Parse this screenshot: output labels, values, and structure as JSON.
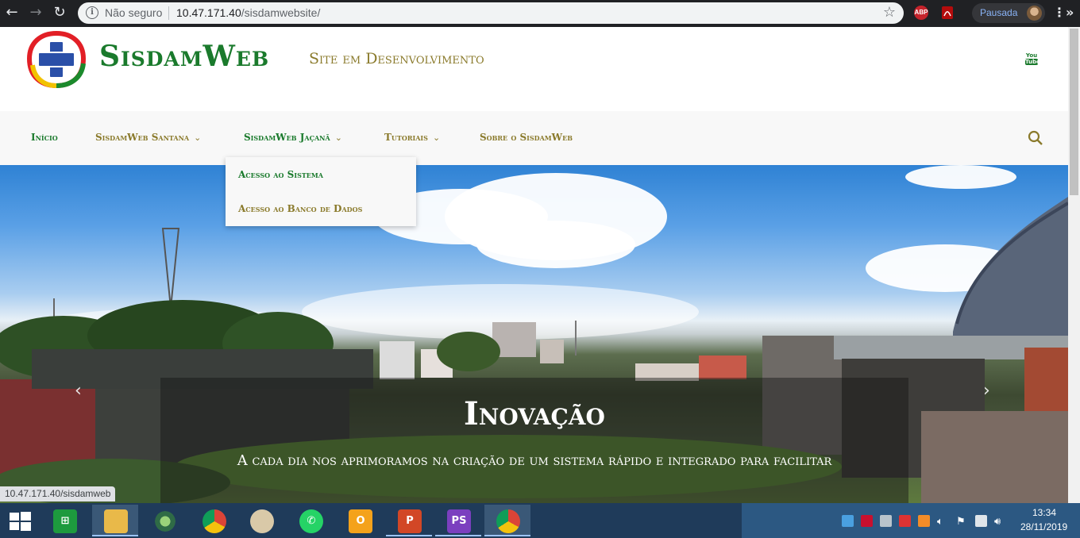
{
  "browser": {
    "security_label": "Não seguro",
    "url_host": "10.47.171.40",
    "url_path": "/sisdamwebsite/",
    "profile_label": "Pausada",
    "ext_abp": "ABP"
  },
  "site": {
    "title": "SisdamWeb",
    "tagline": "Site em Desenvolvimento",
    "youtube_top": "You",
    "youtube_bottom": "Tube"
  },
  "nav": {
    "items": [
      {
        "label": "Início",
        "has_caret": false
      },
      {
        "label": "SisdamWeb Santana",
        "has_caret": true
      },
      {
        "label": "SisdamWeb Jaçanã",
        "has_caret": true
      },
      {
        "label": "Tutoriais",
        "has_caret": true
      },
      {
        "label": "Sobre o SisdamWeb",
        "has_caret": false
      }
    ],
    "dropdown": [
      "Acesso ao Sistema",
      "Acesso ao Banco de Dados"
    ]
  },
  "hero": {
    "title": "Inovação",
    "text": "A cada dia nos aprimoramos na criação de um sistema rápido e integrado para facilitar",
    "prev_arrow": "‹",
    "next_arrow": "›"
  },
  "status_url": "10.47.171.40/sisdamweb",
  "taskbar": {
    "time": "13:34",
    "date": "28/11/2019",
    "ps_label": "PS"
  },
  "colors": {
    "brand_green": "#1a7a2c",
    "brand_olive": "#8a7a2b",
    "chrome_dark": "#202124",
    "taskbar": "#1f3b5a"
  }
}
